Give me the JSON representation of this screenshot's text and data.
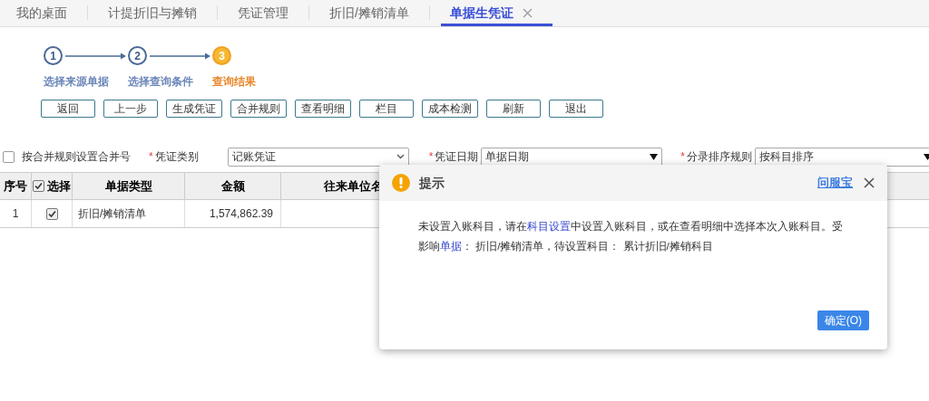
{
  "tabs": [
    {
      "label": "我的桌面",
      "selected": false,
      "closable": false
    },
    {
      "label": "计提折旧与摊销",
      "selected": false,
      "closable": false
    },
    {
      "label": "凭证管理",
      "selected": false,
      "closable": false
    },
    {
      "label": "折旧/摊销清单",
      "selected": false,
      "closable": false
    },
    {
      "label": "单据生凭证",
      "selected": true,
      "closable": true
    }
  ],
  "steps": [
    {
      "number": "1",
      "label": "选择来源单据",
      "current": false
    },
    {
      "number": "2",
      "label": "选择查询条件",
      "current": false
    },
    {
      "number": "3",
      "label": "查询结果",
      "current": true
    }
  ],
  "toolbar": [
    "返回",
    "上一步",
    "生成凭证",
    "合并规则",
    "查看明细",
    "栏目",
    "成本检测",
    "刷新",
    "退出"
  ],
  "options": {
    "merge_checkbox": {
      "label": "按合并规则设置合并号",
      "checked": false
    },
    "fields": [
      {
        "label": "凭证类别",
        "required_mark": "*",
        "value": "记账凭证",
        "kind": "chevron"
      },
      {
        "label": "凭证日期",
        "required_mark": "*",
        "value": "单据日期",
        "kind": "triangle"
      },
      {
        "label": "分录排序规则",
        "required_mark": "*",
        "value": "按科目排序",
        "kind": "triangle"
      }
    ]
  },
  "table": {
    "columns": [
      {
        "label": "序号"
      },
      {
        "label": "选择",
        "checkbox": true,
        "checked": true
      },
      {
        "label": "单据类型"
      },
      {
        "label": "金额"
      },
      {
        "label": "往来单位名"
      }
    ],
    "rows": [
      {
        "index": "1",
        "checked": true,
        "type": "折旧/摊销清单",
        "amount": "1,574,862.39"
      }
    ]
  },
  "dialog": {
    "title": "提示",
    "help_link": "问服宝",
    "message": [
      {
        "kind": "text",
        "text": "未设置入账科目，请在"
      },
      {
        "kind": "link",
        "text": "科目设置"
      },
      {
        "kind": "text",
        "text": "中设置入账科目，或在查看明细中选择本次入账科目。受影响"
      },
      {
        "kind": "link",
        "text": "单据"
      },
      {
        "kind": "text",
        "text": "： 折旧/摊销清单，待设置科目： 累计折旧/摊销科目"
      }
    ],
    "confirm": "确定(O)"
  }
}
